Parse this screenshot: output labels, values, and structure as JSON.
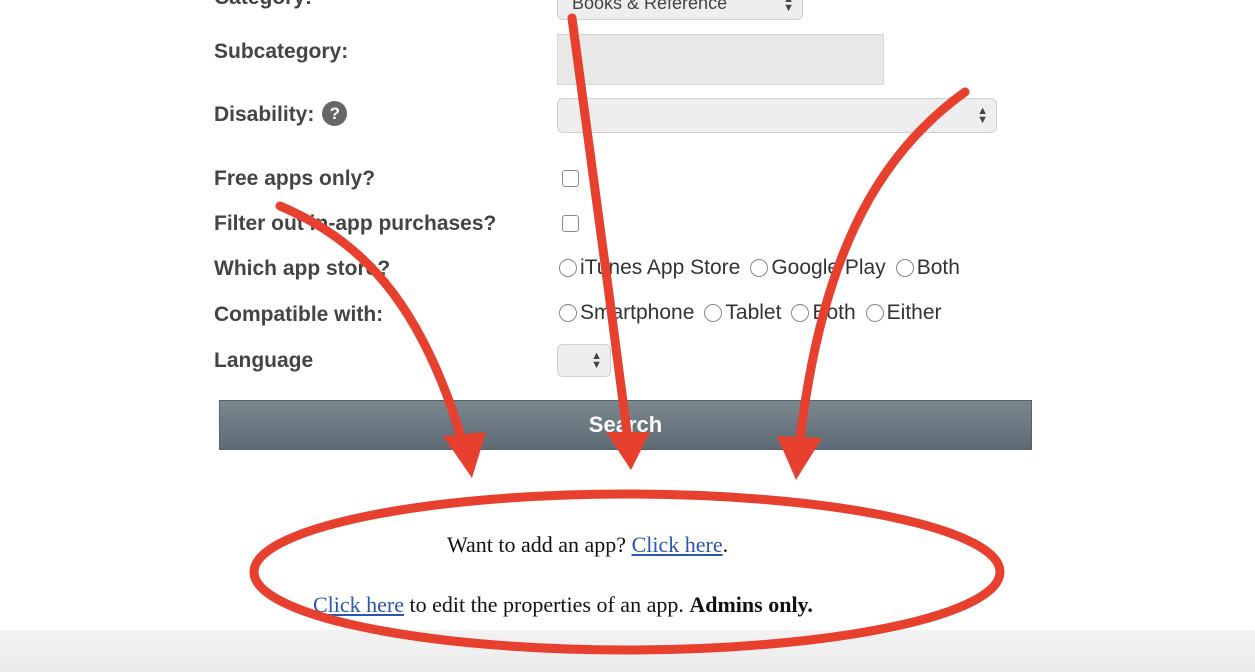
{
  "form": {
    "category_label": "Category:",
    "category_value": "Books & Reference",
    "subcategory_label": "Subcategory:",
    "disability_label": "Disability:",
    "help_glyph": "?",
    "free_apps_label": "Free apps only?",
    "filter_iap_label": "Filter out in-app purchases?",
    "app_store_label": "Which app store?",
    "app_store_options": [
      "iTunes App Store",
      "Google Play",
      "Both"
    ],
    "compatible_label": "Compatible with:",
    "compatible_options": [
      "Smartphone",
      "Tablet",
      "Both",
      "Either"
    ],
    "language_label": "Language",
    "search_button": "Search"
  },
  "footer": {
    "add_app_text": "Want to add an app?",
    "add_app_link": "Click here",
    "add_app_end": ".",
    "edit_link": "Click here",
    "edit_text": " to edit the properties of an app. ",
    "admins_only": "Admins only."
  },
  "annotation": {
    "color": "#e8402f"
  }
}
